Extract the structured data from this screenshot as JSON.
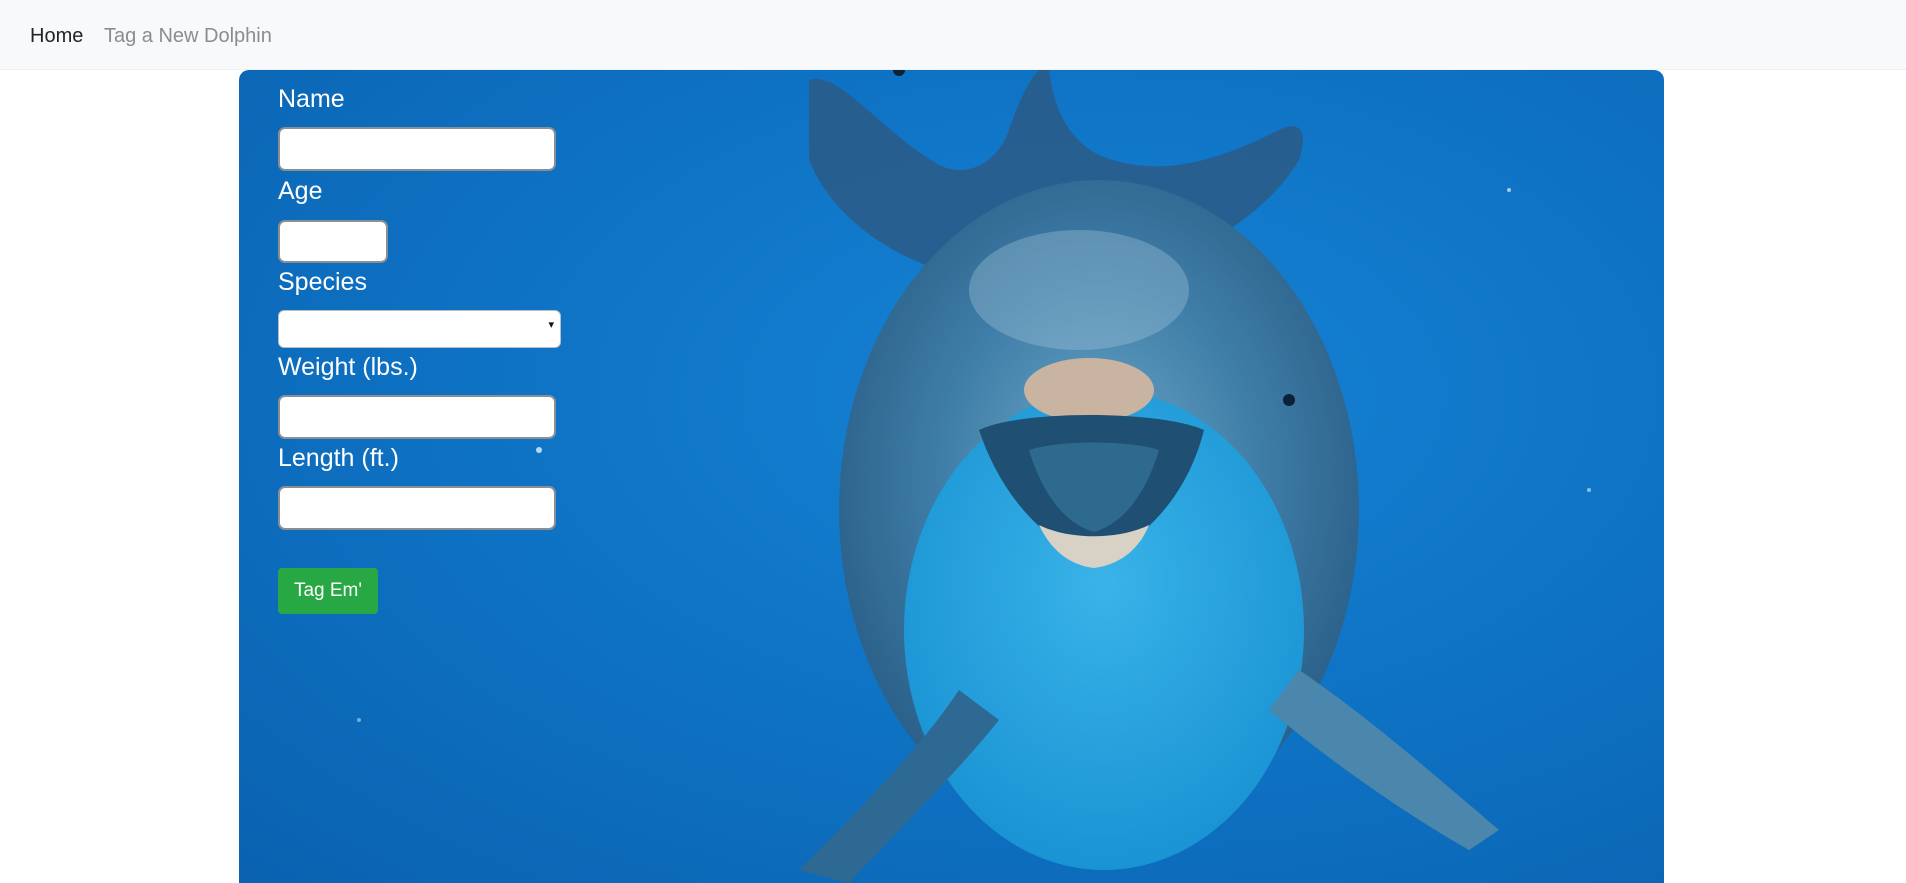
{
  "nav": {
    "home_label": "Home",
    "tag_label": "Tag a New Dolphin"
  },
  "form": {
    "name_label": "Name",
    "name_value": "",
    "age_label": "Age",
    "age_value": "",
    "species_label": "Species",
    "species_value": "",
    "weight_label": "Weight (lbs.)",
    "weight_value": "",
    "length_label": "Length (ft.)",
    "length_value": "",
    "submit_label": "Tag Em'"
  },
  "icons": {
    "select_arrow": "chevron-down-icon"
  },
  "colors": {
    "navbar_bg": "#f8f9fa",
    "water_blue": "#0f74c6",
    "button_green": "#28a745"
  }
}
